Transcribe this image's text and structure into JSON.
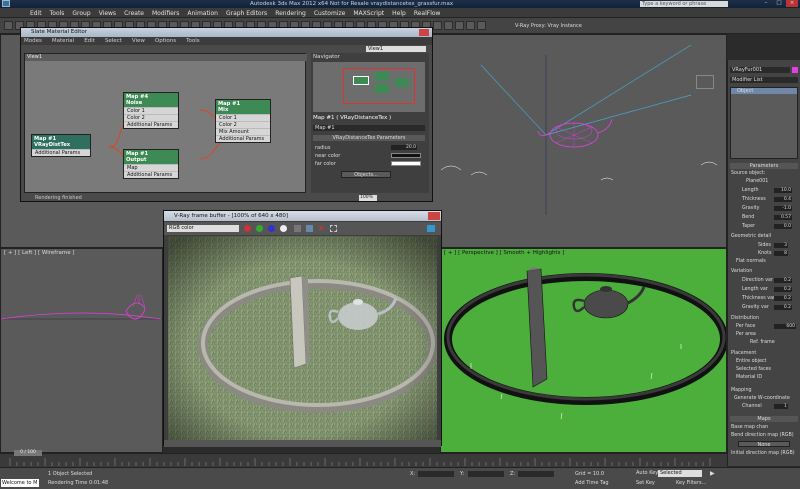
{
  "app": {
    "title": "Autodesk 3ds Max 2012 x64    Not for Resale    vraydistancetex_grassfur.max",
    "search_placeholder": "Type a keyword or phrase"
  },
  "menu": [
    "Edit",
    "Tools",
    "Group",
    "Views",
    "Create",
    "Modifiers",
    "Animation",
    "Graph Editors",
    "Rendering",
    "Customize",
    "MAXScript",
    "Help",
    "RealFlow"
  ],
  "toolbar": {
    "vray_label": "V-Ray Proxy: Vray Instance"
  },
  "viewports": {
    "top_left_label": "",
    "left_label": "[ + ] [ Left ] [ Wireframe ]",
    "perspective_label": "[ + ] [ Perspective ] [ Smooth + Highlights ]"
  },
  "slate": {
    "title": "Slate Material Editor",
    "menus": [
      "Modes",
      "Material",
      "Edit",
      "Select",
      "View",
      "Options",
      "Tools"
    ],
    "view_tab": "View1",
    "dropdown": "View1",
    "navigator": "Navigator",
    "param_title": "Map #1  ( VRayDistanceTex )",
    "map_name": "Map #1",
    "rollout": "VRayDistanceTex Parameters",
    "radius_label": "radius",
    "radius_value": "20.0",
    "near_label": "near color",
    "far_label": "far color",
    "objects_btn": "Objects...",
    "status": "Rendering finished",
    "zoom": "100%",
    "nodes": {
      "noise": {
        "h1": "Map #4",
        "h2": "Noise",
        "rows": [
          "Color 1",
          "Color 2",
          "Additional Params"
        ]
      },
      "mix": {
        "h1": "Map #1",
        "h2": "Mix",
        "rows": [
          "Color 1",
          "Color 2",
          "Mix Amount",
          "Additional Params"
        ]
      },
      "vray": {
        "h1": "Map #1",
        "h2": "VRayDistTex",
        "rows": [
          "Additional Params"
        ]
      },
      "output": {
        "h1": "Map #1",
        "h2": "Output",
        "rows": [
          "Map",
          "Additional Params"
        ]
      }
    }
  },
  "vfb": {
    "title": "V-Ray frame buffer - [100% of 640 x 480]",
    "channel": "RGB color"
  },
  "command_panel": {
    "object_name": "VRayFur001",
    "modifier_list": "Modifier List",
    "stack_item": "Object",
    "parameters": "Parameters",
    "source_object": "Source object:",
    "source_name": "Plane001",
    "rows": [
      {
        "label": "Length",
        "value": "10.0"
      },
      {
        "label": "Thickness",
        "value": "0.4"
      },
      {
        "label": "Gravity",
        "value": "-1.0"
      },
      {
        "label": "Bend",
        "value": "0.57"
      },
      {
        "label": "Taper",
        "value": "0.0"
      }
    ],
    "geo_detail": "Geometric detail",
    "sides_label": "Sides",
    "sides_value": "3",
    "knots_label": "Knots",
    "knots_value": "8",
    "flat_normals": "Flat normals",
    "variation": "Variation",
    "var_rows": [
      {
        "label": "Direction var",
        "value": "0.2"
      },
      {
        "label": "Length var",
        "value": "0.2"
      },
      {
        "label": "Thickness var",
        "value": "0.2"
      },
      {
        "label": "Gravity var",
        "value": "0.2"
      }
    ],
    "distribution": "Distribution",
    "per_face": "Per face",
    "per_face_value": "600",
    "per_area": "Per area",
    "ref_frame": "Ref. frame",
    "placement": "Placement",
    "entire_object": "Entire object",
    "selected_faces": "Selected faces",
    "material_id": "Material ID",
    "mapping": "Mapping",
    "gen_w": "Generate W-coordinate",
    "channel_label": "Channel",
    "channel_value": "1",
    "maps": "Maps",
    "base_map": "Base map chan",
    "bend_dir": "Bend direction map (RGB)",
    "none": "None",
    "init_dir": "Initial direction map (RGB)"
  },
  "status": {
    "frame": "0 / 100",
    "selected": "1 Object Selected",
    "render_time": "Rendering Time  0:01:48",
    "welcome": "Welcome to M",
    "grid": "Grid = 10.0",
    "auto_key": "Auto Key",
    "selected_mode": "Selected",
    "set_key": "Set Key",
    "key_filters": "Key Filters...",
    "add_time_tag": "Add Time Tag",
    "x_label": "X:",
    "y_label": "Y:",
    "z_label": "Z:"
  },
  "colors": {
    "node_header": "#3d8a55",
    "viewport_green": "#4caf3c",
    "teapot_wire": "#e040e0"
  }
}
